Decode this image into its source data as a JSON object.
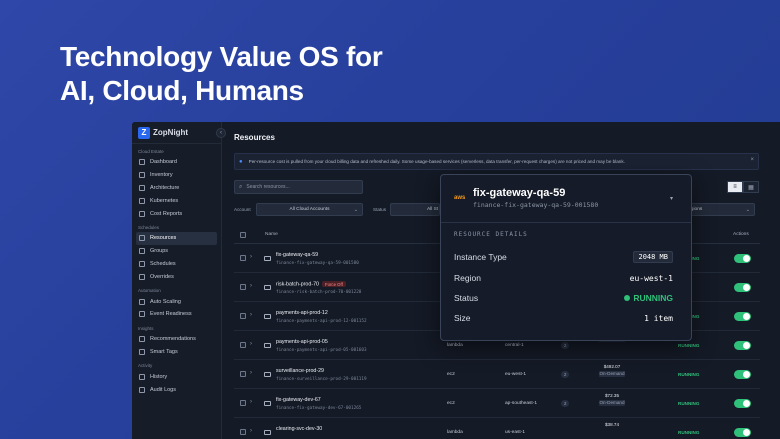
{
  "hero": {
    "line1": "Technology Value OS for",
    "line2": "AI, Cloud, Humans"
  },
  "app": {
    "logo_mark": "Z",
    "logo_text": "ZopNight",
    "collapse": "‹"
  },
  "sidebar": {
    "sections": [
      {
        "label": "Cloud Estate",
        "items": [
          "Dashboard",
          "Inventory",
          "Architecture",
          "Kubernetes",
          "Cost Reports"
        ]
      },
      {
        "label": "Schedules",
        "items": [
          "Resources",
          "Groups",
          "Schedules",
          "Overrides"
        ]
      },
      {
        "label": "Automation",
        "items": [
          "Auto Scaling",
          "Event Readiness"
        ]
      },
      {
        "label": "Insights",
        "items": [
          "Recommendations",
          "Smart Tags"
        ]
      },
      {
        "label": "Activity",
        "items": [
          "History",
          "Audit Logs"
        ]
      }
    ],
    "active_item": "Resources"
  },
  "page": {
    "title": "Resources",
    "info": "Per-resource cost is pulled from your cloud billing data and refreshed daily. Some usage-based services (serverless, data transfer, per-request charges) are not priced and may be blank.",
    "info_close": "×",
    "search_placeholder": "Search resources...",
    "filters": {
      "account_label": "Account",
      "account_value": "All Cloud Accounts",
      "status_label": "Status",
      "status_value": "All St",
      "region_value": "All Regions"
    },
    "columns": {
      "name": "Name",
      "actions": "Actions"
    }
  },
  "rows": [
    {
      "name": "fix-gateway-qa-59",
      "id": "finance-fix-gateway-qa-59-001580",
      "service": "",
      "region": "",
      "tag": "",
      "cost": "",
      "cost_sub": "",
      "status": "RUNNING",
      "badge": ""
    },
    {
      "name": "risk-batch-prod-70",
      "id": "finance-risk-batch-prod-70-001220",
      "service": "",
      "region": "",
      "tag": "",
      "cost": "",
      "cost_sub": "",
      "status": "",
      "badge": "Force Off"
    },
    {
      "name": "payments-api-prod-12",
      "id": "finance-payments-api-prod-12-001152",
      "service": "",
      "region": "",
      "tag": "",
      "cost": "",
      "cost_sub": "",
      "status": "RUNNING",
      "badge": ""
    },
    {
      "name": "payments-api-prod-05",
      "id": "finance-payments-api-prod-05-001603",
      "service": "lambda",
      "region": "central-1",
      "tag": "2",
      "cost": "",
      "cost_sub": "Demand",
      "status": "RUNNING",
      "badge": ""
    },
    {
      "name": "surveillance-prod-29",
      "id": "finance-surveillance-prod-29-001119",
      "service": "ec2",
      "region": "eu-west-1",
      "tag": "2",
      "cost": "$492.07",
      "cost_sub": "On-Demand",
      "status": "RUNNING",
      "badge": ""
    },
    {
      "name": "fix-gateway-dev-67",
      "id": "finance-fix-gateway-dev-67-001265",
      "service": "ec2",
      "region": "ap-southeast-1",
      "tag": "2",
      "cost": "$72.35",
      "cost_sub": "On-Demand",
      "status": "RUNNING",
      "badge": ""
    },
    {
      "name": "clearing-svc-dev-30",
      "id": "",
      "service": "lambda",
      "region": "us-east-1",
      "tag": "",
      "cost": "$38.74",
      "cost_sub": "",
      "status": "RUNNING",
      "badge": ""
    }
  ],
  "popover": {
    "provider": "aws",
    "title": "fix-gateway-qa-59",
    "subtitle": "finance-fix-gateway-qa-59-001580",
    "section": "RESOURCE DETAILS",
    "details": [
      {
        "label": "Instance Type",
        "value": "2048 MB"
      },
      {
        "label": "Region",
        "value": "eu-west-1"
      },
      {
        "label": "Status",
        "value": "RUNNING"
      },
      {
        "label": "Size",
        "value": "1 item"
      }
    ]
  },
  "colors": {
    "accent": "#2a68f0",
    "running": "#2fc07a",
    "aws": "#f59b1c",
    "hero_bg": "#2f47a8"
  }
}
